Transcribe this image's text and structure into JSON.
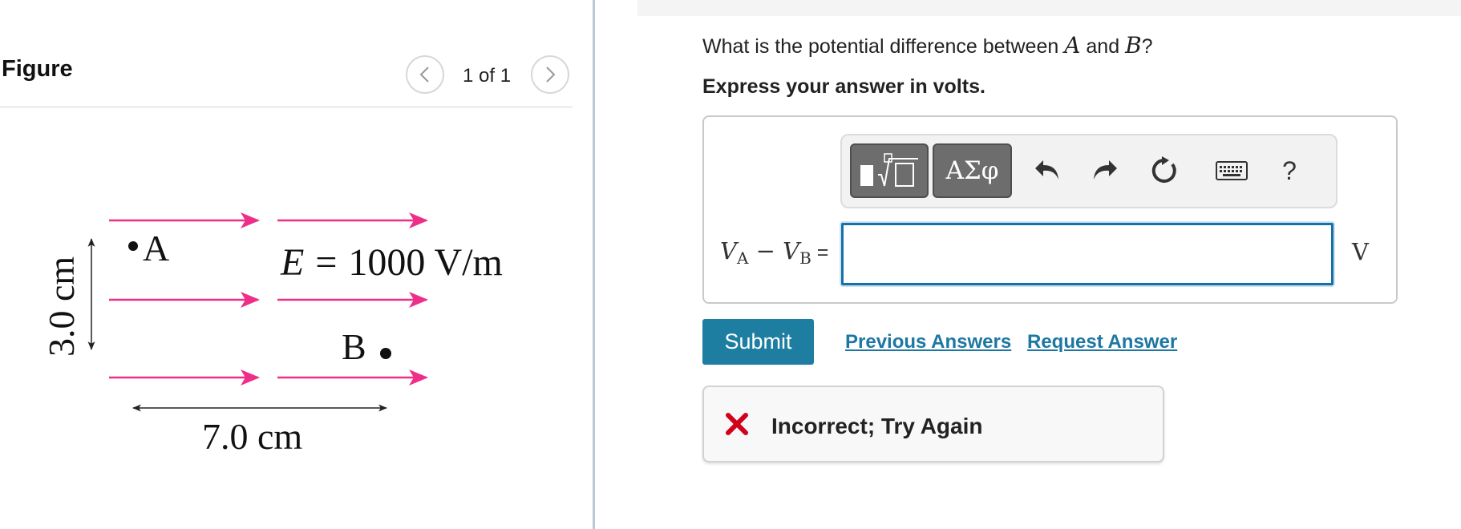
{
  "figure_panel": {
    "title": "Figure",
    "pager": {
      "current_label": "1 of 1"
    },
    "diagram": {
      "point_a_label": "A",
      "point_b_label": "B",
      "field_variable": "E",
      "field_equals": "=",
      "field_value": "1000 V/m",
      "height_label": "3.0 cm",
      "width_label": "7.0 cm",
      "arrow_color": "#ee2e88"
    }
  },
  "question": {
    "text_before": "What is the potential difference between ",
    "var_a": "A",
    "text_middle": " and ",
    "var_b": "B",
    "text_after": "?",
    "instruction": "Express your answer in volts."
  },
  "answer": {
    "toolbar": {
      "templates_icon": "sqrt-template-icon",
      "greek_label": "ΑΣφ",
      "undo_icon": "undo-icon",
      "redo_icon": "redo-icon",
      "reset_icon": "reset-icon",
      "keyboard_icon": "keyboard-icon",
      "help_label": "?"
    },
    "label_v": "V",
    "label_sub_a": "A",
    "label_minus": " − ",
    "label_sub_b": "B",
    "label_equals": " =",
    "input_value": "",
    "unit": "V"
  },
  "actions": {
    "submit_label": "Submit",
    "previous_answers_label": "Previous Answers",
    "request_answer_label": "Request Answer"
  },
  "feedback": {
    "message": "Incorrect; Try Again",
    "icon": "x-icon",
    "status_color": "#d0021b"
  },
  "colors": {
    "accent": "#1d7ea1",
    "input_border": "#1472a8"
  }
}
